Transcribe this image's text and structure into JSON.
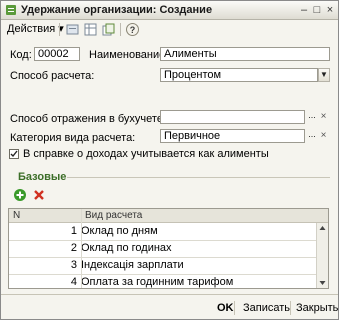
{
  "window": {
    "title": "Удержание организации: Создание"
  },
  "toolbar": {
    "actions_label": "Действия",
    "actions_arrow": "▾"
  },
  "form": {
    "code_label": "Код:",
    "code_value": "00002",
    "name_label": "Наименование:",
    "name_value": "Алименты",
    "calc_method_label": "Способ расчета:",
    "calc_method_value": "Процентом",
    "accounting_label": "Способ отражения в бухучете:",
    "accounting_value": "",
    "category_label": "Категория вида расчета:",
    "category_value": "Первичное",
    "alimony_checkbox_label": "В справке о доходах учитывается как алименты",
    "alimony_checked": true,
    "ellipsis": "...",
    "clear": "×"
  },
  "base_section": {
    "title": "Базовые",
    "columns": [
      "N",
      "Вид расчета"
    ],
    "rows": [
      {
        "n": "1",
        "name": "Оклад по дням"
      },
      {
        "n": "2",
        "name": "Оклад по годинах"
      },
      {
        "n": "3",
        "name": "Індексація зарплати"
      },
      {
        "n": "4",
        "name": "Оплата за годинним тарифом"
      }
    ]
  },
  "footer": {
    "ok": "OK",
    "save": "Записать",
    "close": "Закрыть"
  },
  "colors": {
    "section_green": "#3c6e28",
    "add_green": "#3a9a2a",
    "delete_red": "#d03020"
  }
}
